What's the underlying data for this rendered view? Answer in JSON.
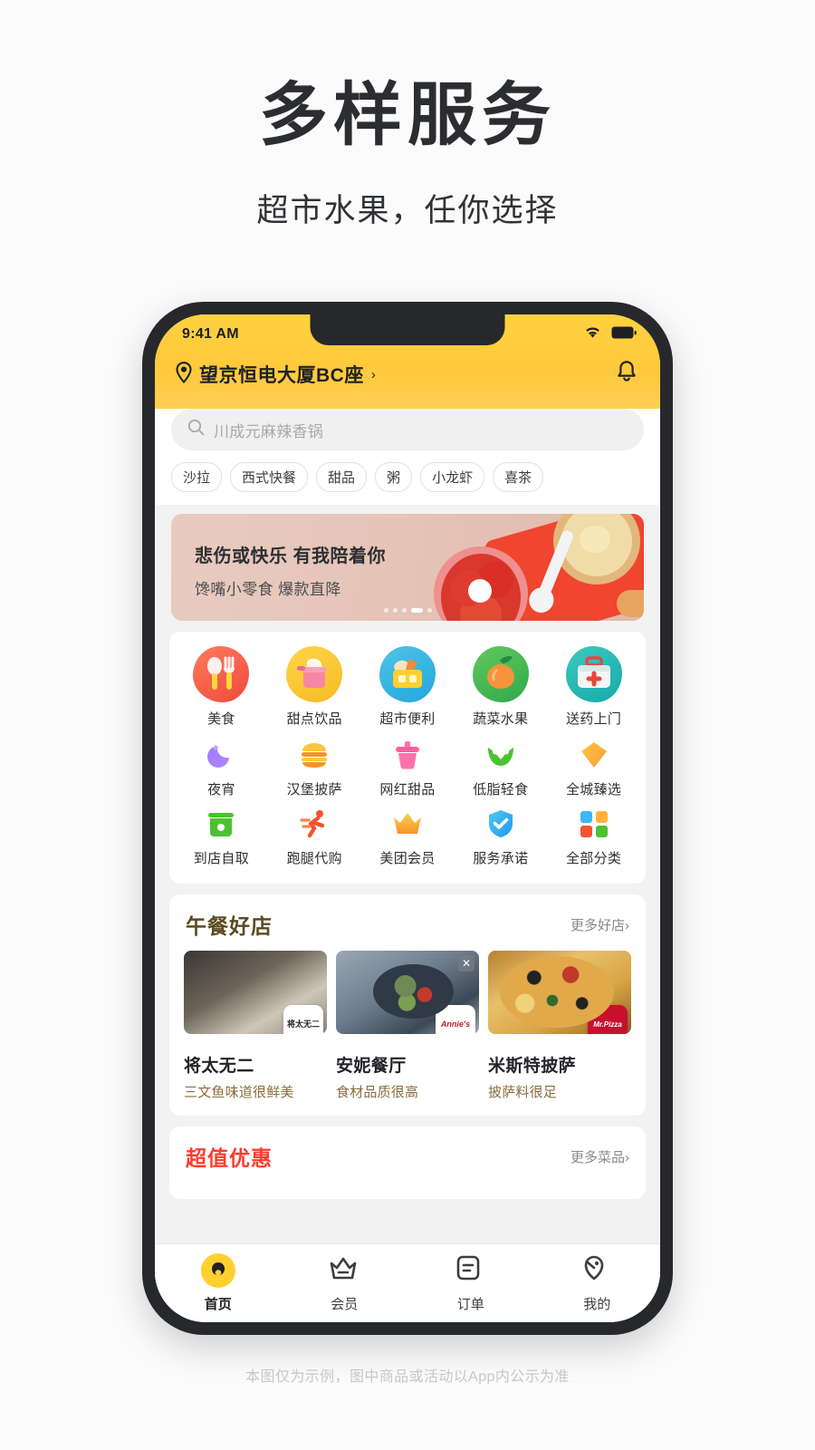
{
  "headline": {
    "title": "多样服务",
    "subtitle": "超市水果，任你选择"
  },
  "footnote": "本图仅为示例，图中商品或活动以App内公示为准",
  "colors": {
    "header_yellow": "#ffc93b",
    "accent_red": "#ff3b2f",
    "tab_active": "#ffd02e",
    "section_title_brown": "#5b4a1f"
  },
  "phone": {
    "statusbar": {
      "time": "9:41 AM",
      "wifi_icon": "wifi-icon",
      "battery_icon": "battery-icon"
    },
    "header": {
      "location_icon": "location-pin-icon",
      "location": "望京恒电大厦BC座",
      "location_arrow": "›",
      "bell_icon": "bell-icon"
    },
    "search": {
      "icon": "search-icon",
      "placeholder": "川成元麻辣香锅"
    },
    "chips": [
      "沙拉",
      "西式快餐",
      "甜品",
      "粥",
      "小龙虾",
      "喜茶"
    ],
    "banner": {
      "title": "悲伤或快乐 有我陪着你",
      "subtitle": "馋嘴小零食 爆款直降",
      "dots_total": 5,
      "dots_active_index": 3
    },
    "grid": {
      "row1": [
        {
          "label": "美食",
          "icon": "utensils-icon"
        },
        {
          "label": "甜点饮品",
          "icon": "ice-cream-icon"
        },
        {
          "label": "超市便利",
          "icon": "shopping-basket-icon"
        },
        {
          "label": "蔬菜水果",
          "icon": "peach-fruit-icon"
        },
        {
          "label": "送药上门",
          "icon": "medical-kit-icon"
        }
      ],
      "row2": [
        {
          "label": "夜宵",
          "icon": "moon-icon"
        },
        {
          "label": "汉堡披萨",
          "icon": "burger-icon"
        },
        {
          "label": "网红甜品",
          "icon": "dessert-cup-icon"
        },
        {
          "label": "低脂轻食",
          "icon": "leaf-icon"
        },
        {
          "label": "全城臻选",
          "icon": "diamond-icon"
        }
      ],
      "row3": [
        {
          "label": "到店自取",
          "icon": "storefront-icon"
        },
        {
          "label": "跑腿代购",
          "icon": "runner-icon"
        },
        {
          "label": "美团会员",
          "icon": "crown-icon"
        },
        {
          "label": "服务承诺",
          "icon": "shield-check-icon"
        },
        {
          "label": "全部分类",
          "icon": "grid-squares-icon"
        }
      ]
    },
    "stores_section": {
      "title": "午餐好店",
      "more_label": "更多好店",
      "more_arrow": "›",
      "items": [
        {
          "name": "将太无二",
          "desc": "三文鱼味道很鲜美",
          "logo_text": "将太无二",
          "logo_kind": "sushi"
        },
        {
          "name": "安妮餐厅",
          "desc": "食材品质很高",
          "logo_text": "Annie's",
          "logo_kind": "annies",
          "close_icon": "close-icon"
        },
        {
          "name": "米斯特披萨",
          "desc": "披萨料很足",
          "logo_text": "Mr.Pizza",
          "logo_kind": "mrpizza"
        }
      ]
    },
    "deals_section": {
      "title": "超值优惠",
      "more_label": "更多菜品",
      "more_arrow": "›"
    },
    "tabbar": [
      {
        "label": "首页",
        "icon": "home-icon",
        "active": true
      },
      {
        "label": "会员",
        "icon": "member-crown-icon",
        "active": false
      },
      {
        "label": "订单",
        "icon": "order-list-icon",
        "active": false
      },
      {
        "label": "我的",
        "icon": "profile-icon",
        "active": false
      }
    ]
  }
}
